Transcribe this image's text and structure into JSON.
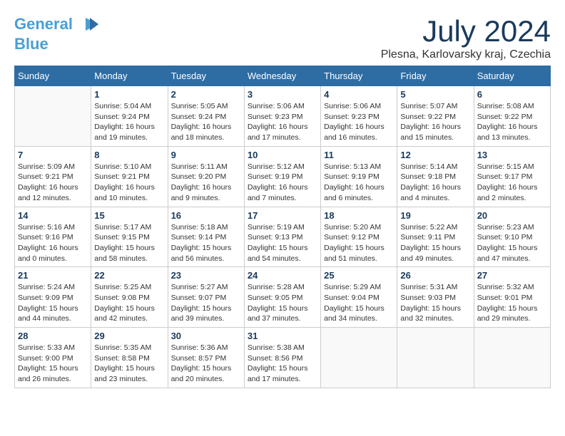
{
  "header": {
    "logo_line1": "General",
    "logo_line2": "Blue",
    "month_title": "July 2024",
    "location": "Plesna, Karlovarsky kraj, Czechia"
  },
  "days_of_week": [
    "Sunday",
    "Monday",
    "Tuesday",
    "Wednesday",
    "Thursday",
    "Friday",
    "Saturday"
  ],
  "weeks": [
    [
      {
        "day": "",
        "info": ""
      },
      {
        "day": "1",
        "info": "Sunrise: 5:04 AM\nSunset: 9:24 PM\nDaylight: 16 hours\nand 19 minutes."
      },
      {
        "day": "2",
        "info": "Sunrise: 5:05 AM\nSunset: 9:24 PM\nDaylight: 16 hours\nand 18 minutes."
      },
      {
        "day": "3",
        "info": "Sunrise: 5:06 AM\nSunset: 9:23 PM\nDaylight: 16 hours\nand 17 minutes."
      },
      {
        "day": "4",
        "info": "Sunrise: 5:06 AM\nSunset: 9:23 PM\nDaylight: 16 hours\nand 16 minutes."
      },
      {
        "day": "5",
        "info": "Sunrise: 5:07 AM\nSunset: 9:22 PM\nDaylight: 16 hours\nand 15 minutes."
      },
      {
        "day": "6",
        "info": "Sunrise: 5:08 AM\nSunset: 9:22 PM\nDaylight: 16 hours\nand 13 minutes."
      }
    ],
    [
      {
        "day": "7",
        "info": "Sunrise: 5:09 AM\nSunset: 9:21 PM\nDaylight: 16 hours\nand 12 minutes."
      },
      {
        "day": "8",
        "info": "Sunrise: 5:10 AM\nSunset: 9:21 PM\nDaylight: 16 hours\nand 10 minutes."
      },
      {
        "day": "9",
        "info": "Sunrise: 5:11 AM\nSunset: 9:20 PM\nDaylight: 16 hours\nand 9 minutes."
      },
      {
        "day": "10",
        "info": "Sunrise: 5:12 AM\nSunset: 9:19 PM\nDaylight: 16 hours\nand 7 minutes."
      },
      {
        "day": "11",
        "info": "Sunrise: 5:13 AM\nSunset: 9:19 PM\nDaylight: 16 hours\nand 6 minutes."
      },
      {
        "day": "12",
        "info": "Sunrise: 5:14 AM\nSunset: 9:18 PM\nDaylight: 16 hours\nand 4 minutes."
      },
      {
        "day": "13",
        "info": "Sunrise: 5:15 AM\nSunset: 9:17 PM\nDaylight: 16 hours\nand 2 minutes."
      }
    ],
    [
      {
        "day": "14",
        "info": "Sunrise: 5:16 AM\nSunset: 9:16 PM\nDaylight: 16 hours\nand 0 minutes."
      },
      {
        "day": "15",
        "info": "Sunrise: 5:17 AM\nSunset: 9:15 PM\nDaylight: 15 hours\nand 58 minutes."
      },
      {
        "day": "16",
        "info": "Sunrise: 5:18 AM\nSunset: 9:14 PM\nDaylight: 15 hours\nand 56 minutes."
      },
      {
        "day": "17",
        "info": "Sunrise: 5:19 AM\nSunset: 9:13 PM\nDaylight: 15 hours\nand 54 minutes."
      },
      {
        "day": "18",
        "info": "Sunrise: 5:20 AM\nSunset: 9:12 PM\nDaylight: 15 hours\nand 51 minutes."
      },
      {
        "day": "19",
        "info": "Sunrise: 5:22 AM\nSunset: 9:11 PM\nDaylight: 15 hours\nand 49 minutes."
      },
      {
        "day": "20",
        "info": "Sunrise: 5:23 AM\nSunset: 9:10 PM\nDaylight: 15 hours\nand 47 minutes."
      }
    ],
    [
      {
        "day": "21",
        "info": "Sunrise: 5:24 AM\nSunset: 9:09 PM\nDaylight: 15 hours\nand 44 minutes."
      },
      {
        "day": "22",
        "info": "Sunrise: 5:25 AM\nSunset: 9:08 PM\nDaylight: 15 hours\nand 42 minutes."
      },
      {
        "day": "23",
        "info": "Sunrise: 5:27 AM\nSunset: 9:07 PM\nDaylight: 15 hours\nand 39 minutes."
      },
      {
        "day": "24",
        "info": "Sunrise: 5:28 AM\nSunset: 9:05 PM\nDaylight: 15 hours\nand 37 minutes."
      },
      {
        "day": "25",
        "info": "Sunrise: 5:29 AM\nSunset: 9:04 PM\nDaylight: 15 hours\nand 34 minutes."
      },
      {
        "day": "26",
        "info": "Sunrise: 5:31 AM\nSunset: 9:03 PM\nDaylight: 15 hours\nand 32 minutes."
      },
      {
        "day": "27",
        "info": "Sunrise: 5:32 AM\nSunset: 9:01 PM\nDaylight: 15 hours\nand 29 minutes."
      }
    ],
    [
      {
        "day": "28",
        "info": "Sunrise: 5:33 AM\nSunset: 9:00 PM\nDaylight: 15 hours\nand 26 minutes."
      },
      {
        "day": "29",
        "info": "Sunrise: 5:35 AM\nSunset: 8:58 PM\nDaylight: 15 hours\nand 23 minutes."
      },
      {
        "day": "30",
        "info": "Sunrise: 5:36 AM\nSunset: 8:57 PM\nDaylight: 15 hours\nand 20 minutes."
      },
      {
        "day": "31",
        "info": "Sunrise: 5:38 AM\nSunset: 8:56 PM\nDaylight: 15 hours\nand 17 minutes."
      },
      {
        "day": "",
        "info": ""
      },
      {
        "day": "",
        "info": ""
      },
      {
        "day": "",
        "info": ""
      }
    ]
  ]
}
